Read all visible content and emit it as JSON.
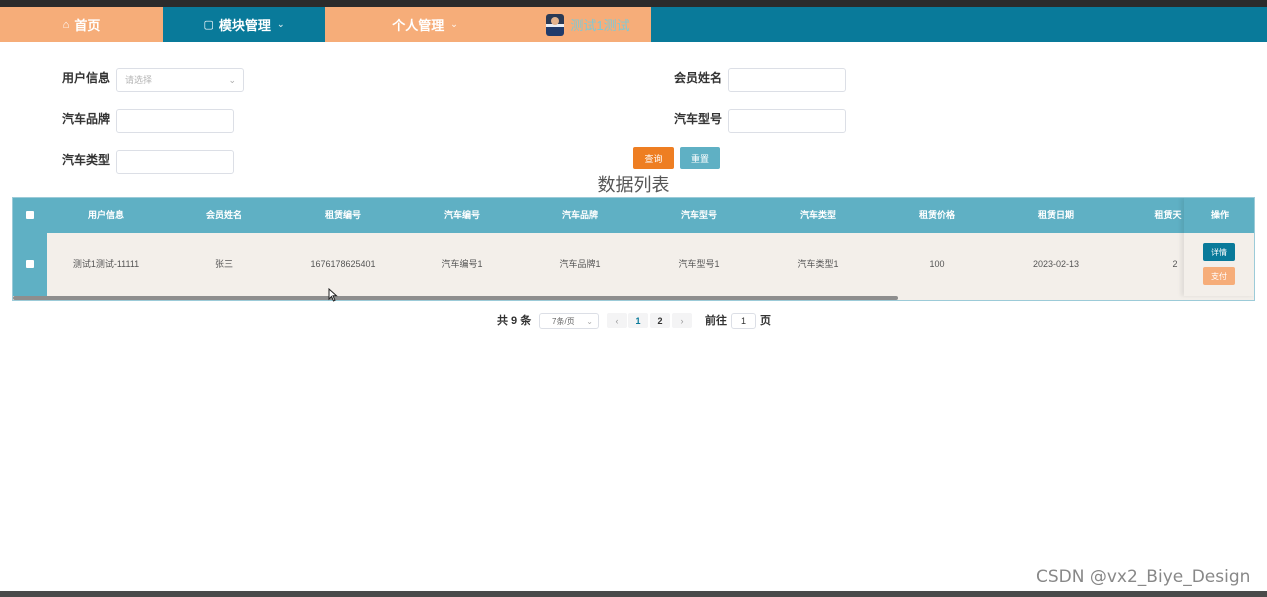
{
  "nav": {
    "home": {
      "icon": "home-icon",
      "label": "首页"
    },
    "module": {
      "icon": "module-icon",
      "label": "模块管理"
    },
    "personal": {
      "label": "个人管理"
    },
    "user": {
      "label": "测试1测试"
    }
  },
  "search": {
    "user_info_label": "用户信息",
    "user_info_placeholder": "请选择",
    "member_name_label": "会员姓名",
    "member_name_value": "",
    "brand_label": "汽车品牌",
    "brand_value": "",
    "model_label": "汽车型号",
    "model_value": "",
    "type_label": "汽车类型",
    "type_value": "",
    "query_label": "查询",
    "reset_label": "重置"
  },
  "table": {
    "title": "数据列表",
    "columns": [
      "用户信息",
      "会员姓名",
      "租赁编号",
      "汽车编号",
      "汽车品牌",
      "汽车型号",
      "汽车类型",
      "租赁价格",
      "租赁日期",
      "租赁天",
      "操作"
    ],
    "rows": [
      {
        "user_info": "测试1测试-11111",
        "member_name": "张三",
        "rental_no": "1676178625401",
        "car_no": "汽车编号1",
        "brand": "汽车品牌1",
        "model": "汽车型号1",
        "car_type": "汽车类型1",
        "price": "100",
        "date": "2023-02-13",
        "days": "2",
        "detail_label": "详情",
        "pay_label": "支付"
      }
    ]
  },
  "pagination": {
    "total_text": "共 9 条",
    "page_size": "7条/页",
    "prev": "‹",
    "pages": [
      "1",
      "2"
    ],
    "current_page": "1",
    "next": "›",
    "goto_label": "前往",
    "goto_value": "1",
    "page_suffix": "页"
  },
  "watermark": "CSDN @vx2_Biye_Design",
  "colors": {
    "nav_teal": "#097a9a",
    "nav_peach": "#f6ad79",
    "table_header": "#5fb0c4",
    "query_orange": "#ee7e22"
  }
}
